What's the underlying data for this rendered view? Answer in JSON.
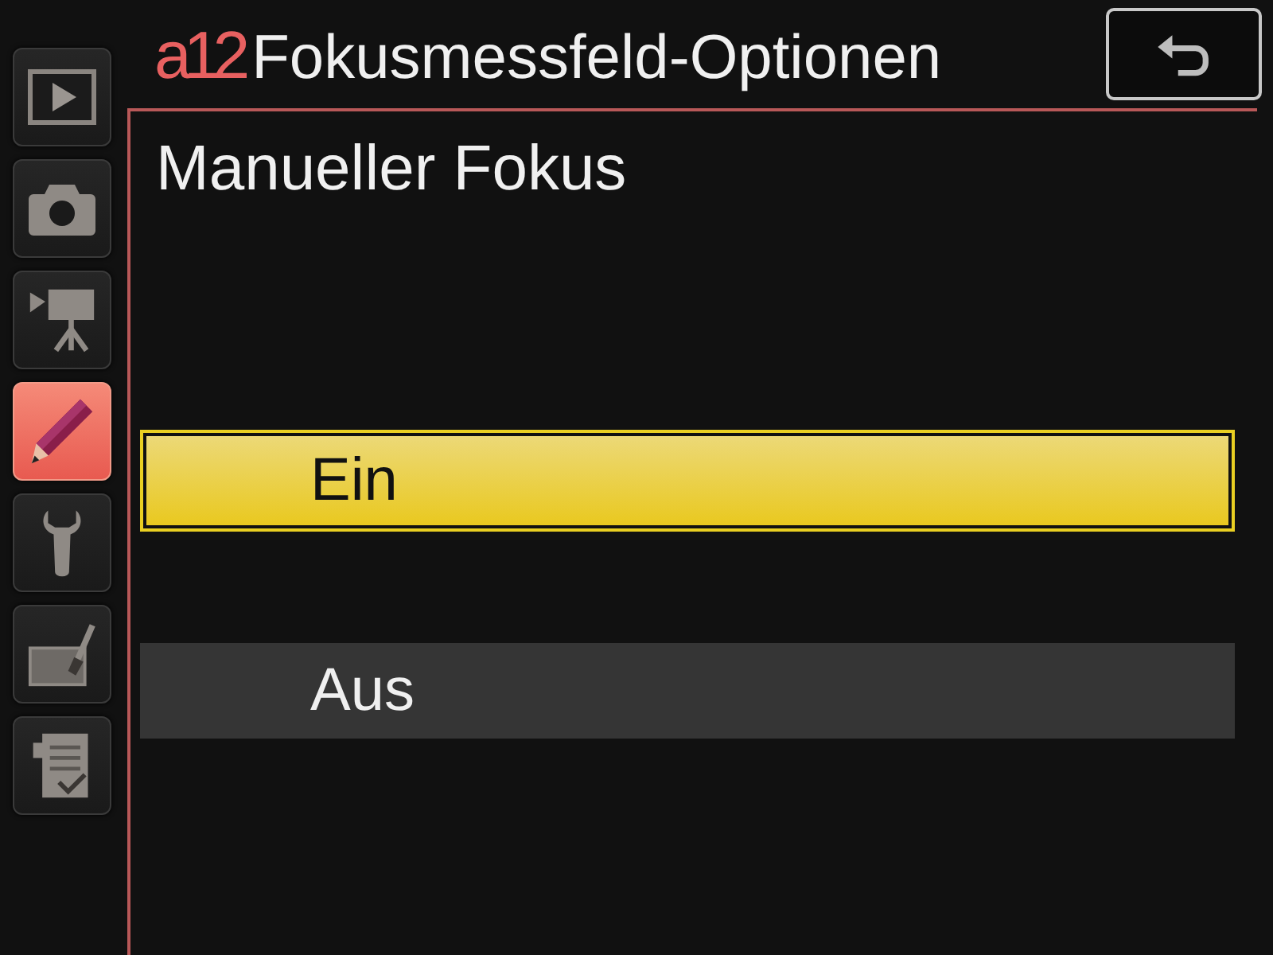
{
  "tabs": [
    {
      "kind": "playback",
      "selected": false
    },
    {
      "kind": "photo",
      "selected": false
    },
    {
      "kind": "movie",
      "selected": false
    },
    {
      "kind": "custom",
      "selected": true
    },
    {
      "kind": "setup",
      "selected": false
    },
    {
      "kind": "retouch",
      "selected": false
    },
    {
      "kind": "recent",
      "selected": false
    }
  ],
  "header": {
    "code": "a12",
    "title": "Fokusmessfeld-Optionen"
  },
  "page": {
    "heading": "Manueller Fokus",
    "options": [
      {
        "label": "Ein",
        "selected": true
      },
      {
        "label": "Aus",
        "selected": false
      }
    ]
  }
}
